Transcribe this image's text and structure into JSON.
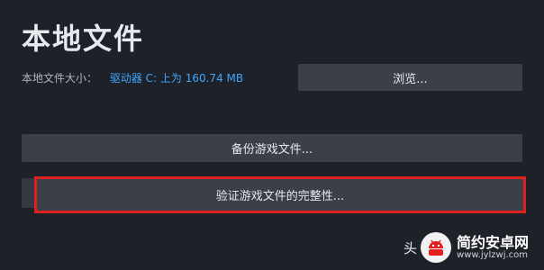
{
  "header": {
    "title": "本地文件"
  },
  "size": {
    "label": "本地文件大小：",
    "value": "驱动器 C: 上为 160.74 MB"
  },
  "buttons": {
    "browse": "浏览...",
    "backup": "备份游戏文件...",
    "verify": "验证游戏文件的完整性..."
  },
  "watermark": {
    "prefix": "头",
    "name": "简约安卓网",
    "url": "www.jylzwj.com"
  },
  "colors": {
    "accent": "#3ea6ff",
    "highlight": "#e0201e",
    "background": "#1e2128",
    "button": "#3a3f48"
  }
}
